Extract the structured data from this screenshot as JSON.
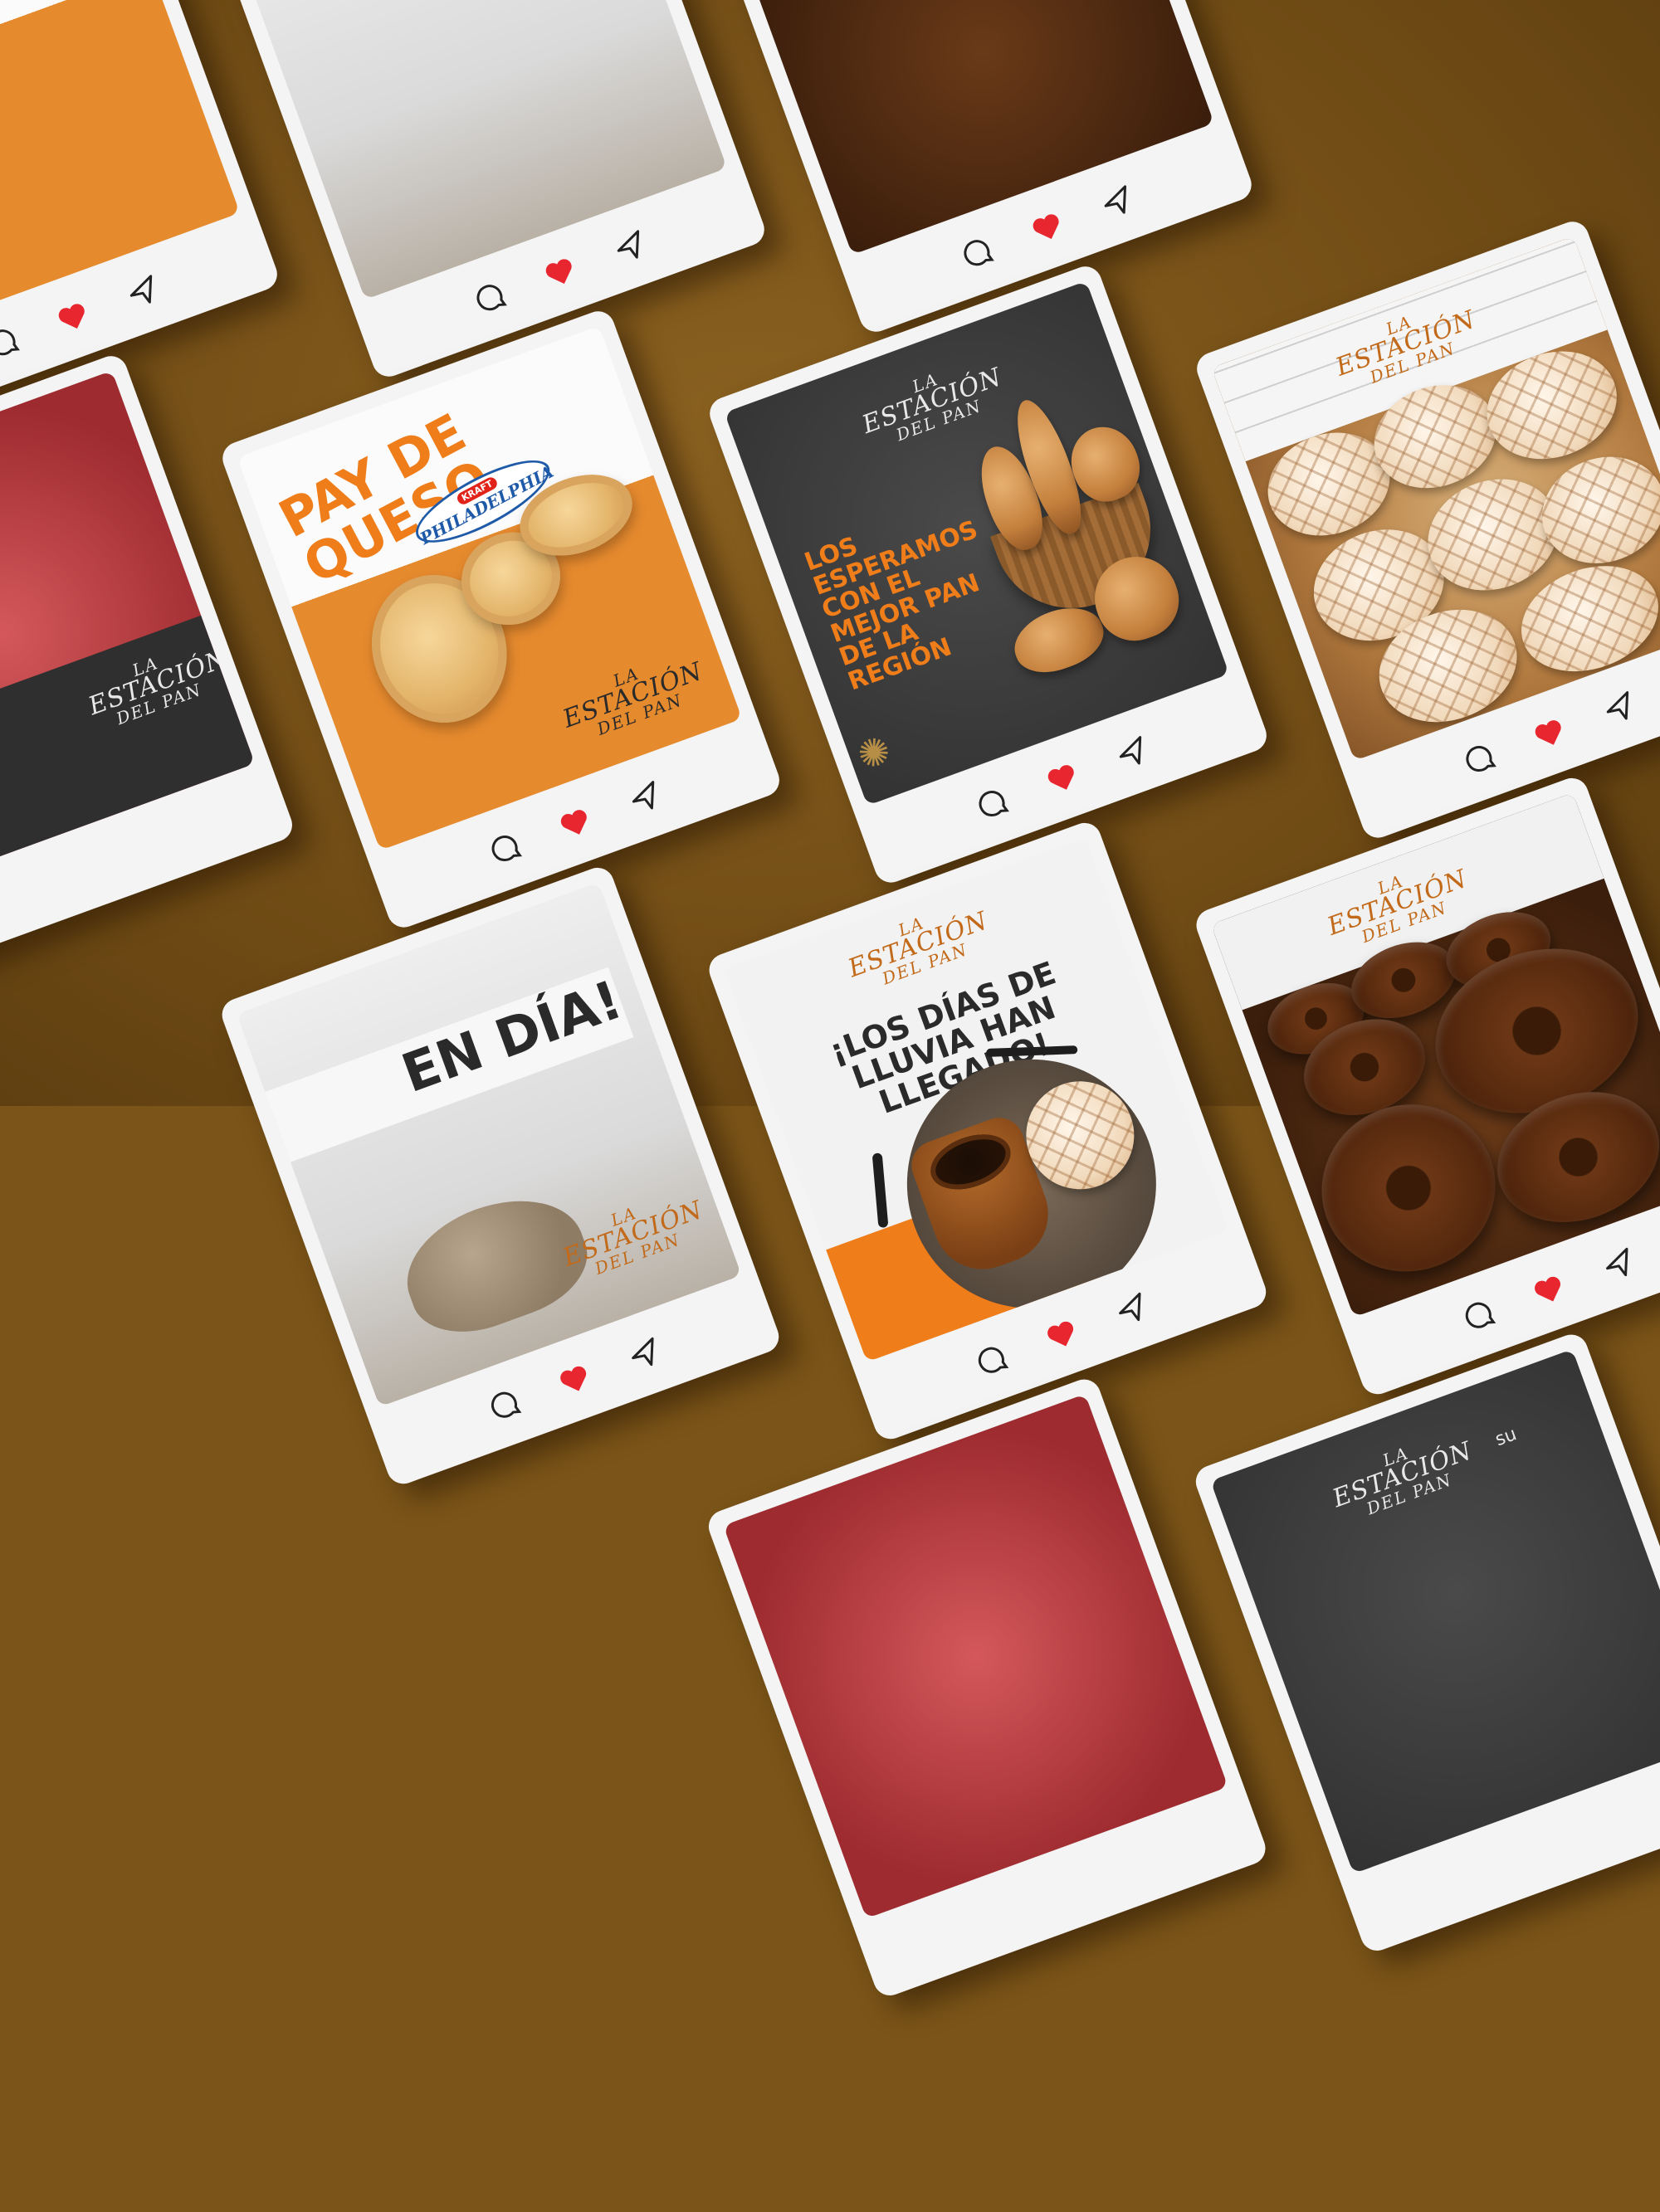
{
  "palette": {
    "background": "#7a5418",
    "card": "#f4f4f4",
    "orange": "#ef7d1a",
    "heart": "#e8262f",
    "dark": "#2a2a2a"
  },
  "icons": {
    "comment": "comment-bubble-icon",
    "like": "heart-icon",
    "share": "send-paper-plane-icon"
  },
  "brand": {
    "line1": "LA",
    "line2": "ESTACIÓN",
    "line3": "DEL PAN"
  },
  "posts": {
    "pay": {
      "title": "PAY DE QUESO",
      "kraft": "KRAFT",
      "product": "PHILADELPHIA",
      "liked": true
    },
    "basket": {
      "headline": "LOS ESPERAMOS CON EL MEJOR PAN DE LA REGIÓN",
      "liked": true
    },
    "conchas": {
      "liked": false
    },
    "rain": {
      "headline": "¡LOS DÍAS DE LLUVIA HAN LLEGADO!",
      "liked": true
    },
    "donuts": {
      "liked": true
    },
    "baker": {
      "headline": "EN DÍA!",
      "liked": true
    },
    "dark_bottom": {
      "partial_text": "su",
      "liked": false
    }
  }
}
